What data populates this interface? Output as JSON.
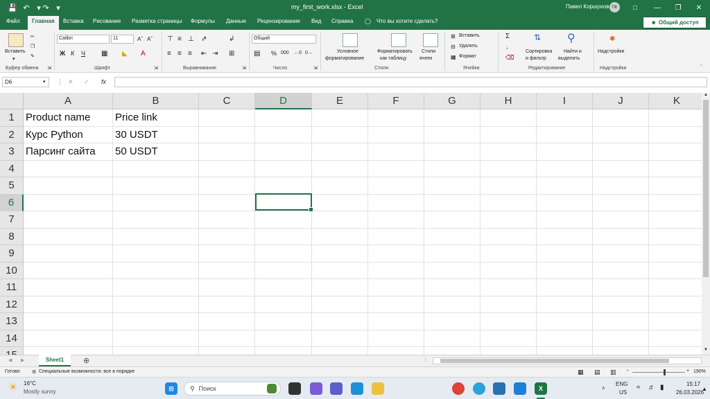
{
  "app": {
    "title": "my_first_work.xlsx  -  Excel",
    "user_name": "Павел Коршунов",
    "user_initials": "ПК",
    "accent_color": "#217346"
  },
  "quick_access": [
    "save-icon",
    "undo-icon",
    "redo-icon",
    "customize-icon"
  ],
  "tabs": [
    {
      "label": "Файл"
    },
    {
      "label": "Главная"
    },
    {
      "label": "Вставка"
    },
    {
      "label": "Рисование"
    },
    {
      "label": "Разметка страницы"
    },
    {
      "label": "Формулы"
    },
    {
      "label": "Данные"
    },
    {
      "label": "Рецензирование"
    },
    {
      "label": "Вид"
    },
    {
      "label": "Справка"
    }
  ],
  "tell_me": "Что вы хотите сделать?",
  "share_label": "Общий доступ",
  "ribbon": {
    "paste": "Вставить",
    "font_name": "Calibri",
    "font_size": "11",
    "bold": "Ж",
    "italic": "К",
    "underline": "Ч",
    "number_format": "Общий",
    "percent": "%",
    "thousands": "000",
    "conditional": [
      "Условное",
      "форматирование"
    ],
    "format_table": [
      "Форматировать",
      "как таблицу"
    ],
    "cell_styles": [
      "Стили",
      "ячеек"
    ],
    "insert": "Вставить",
    "delete": "Удалить",
    "format": "Формат",
    "sort": [
      "Сортировка",
      "и фильтр"
    ],
    "find": [
      "Найти и",
      "выделить"
    ],
    "addins": "Надстройки",
    "groups": {
      "clipboard": "Буфер обмена",
      "font": "Шрифт",
      "alignment": "Выравнивание",
      "number": "Число",
      "styles": "Стили",
      "cells": "Ячейки",
      "editing": "Редактирование",
      "addins": "Надстройки"
    }
  },
  "formula_bar": {
    "name_box": "D6",
    "formula": "",
    "fx": "fx"
  },
  "grid": {
    "columns": [
      "A",
      "B",
      "C",
      "D",
      "E",
      "F",
      "G",
      "H",
      "I",
      "J",
      "K"
    ],
    "rows": [
      "1",
      "2",
      "3",
      "4",
      "5",
      "6",
      "7",
      "8",
      "9",
      "10",
      "11",
      "12",
      "13",
      "14",
      "15"
    ],
    "selected_col": "D",
    "selected_row": "6",
    "cells": [
      {
        "ref": "A1",
        "value": "Product name"
      },
      {
        "ref": "B1",
        "value": "Price link"
      },
      {
        "ref": "A2",
        "value": "Курс Python"
      },
      {
        "ref": "B2",
        "value": "30 USDT"
      },
      {
        "ref": "A3",
        "value": "Парсинг сайта"
      },
      {
        "ref": "B3",
        "value": "50 USDT"
      }
    ]
  },
  "sheets": [
    {
      "name": "Sheet1",
      "active": true
    }
  ],
  "status": {
    "ready": "Готово",
    "accessibility": "Специальные возможности: все в порядке",
    "zoom": "190%"
  },
  "taskbar": {
    "weather_temp": "16°C",
    "weather_desc": "Mostly sunny",
    "search": "Поиск",
    "lang": "ENG",
    "region": "US",
    "time": "15:17",
    "date": "26.03.2026"
  }
}
